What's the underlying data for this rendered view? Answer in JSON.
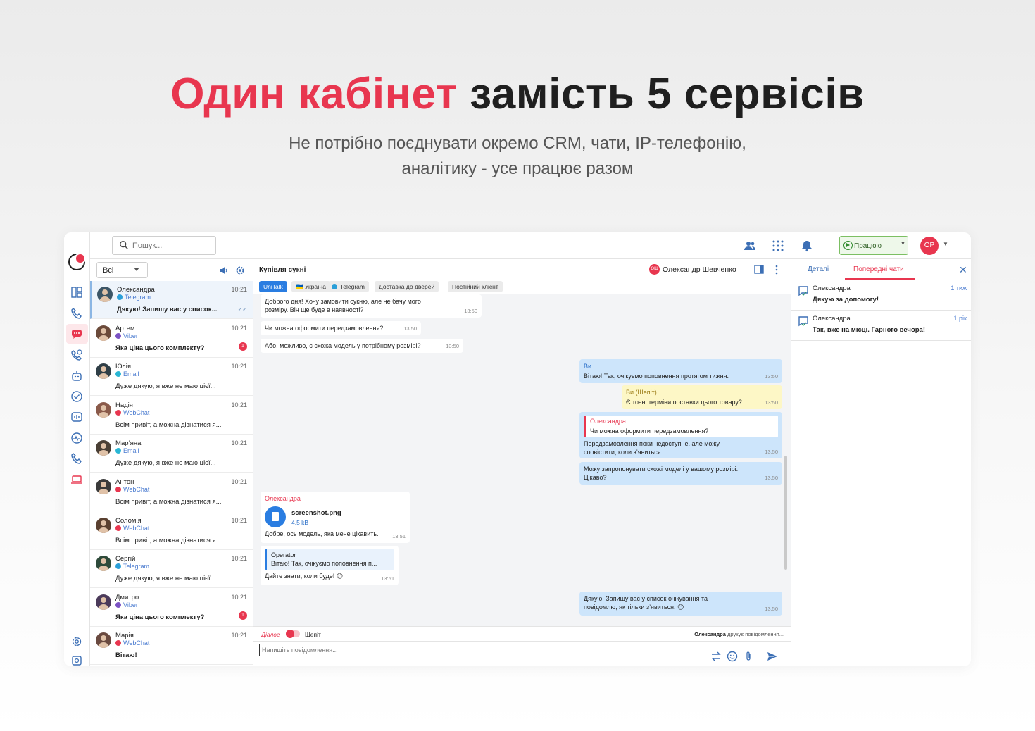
{
  "hero": {
    "title_accent": "Один кабінет",
    "title_rest": "замість 5 сервісів",
    "subtitle_line1": "Не потрібно поєднувати окремо CRM, чати, IP-телефонію,",
    "subtitle_line2": "аналітику - усе працює разом"
  },
  "topbar": {
    "search_placeholder": "Пошук...",
    "status_label": "Працюю",
    "user_initials": "ОР"
  },
  "convlist": {
    "filter_value": "Всі",
    "items": [
      {
        "name": "Олександра",
        "channel": "Telegram",
        "channel_color": "#2a9fd8",
        "time": "10:21",
        "message": "Дякую! Запишу вас у список...",
        "bold": true,
        "badge": "",
        "selected": true
      },
      {
        "name": "Артем",
        "channel": "Viber",
        "channel_color": "#7b52c4",
        "time": "10:21",
        "message": "Яка ціна цього комплекту?",
        "bold": true,
        "badge": "1",
        "selected": false
      },
      {
        "name": "Юлія",
        "channel": "Email",
        "channel_color": "#29b6d4",
        "time": "10:21",
        "message": "Дуже дякую, я вже не маю цієї...",
        "bold": false,
        "badge": "",
        "selected": false
      },
      {
        "name": "Надія",
        "channel": "WebChat",
        "channel_color": "#e8364f",
        "time": "10:21",
        "message": "Всім привіт, а можна дізнатися я...",
        "bold": false,
        "badge": "",
        "selected": false
      },
      {
        "name": "Мар’яна",
        "channel": "Email",
        "channel_color": "#29b6d4",
        "time": "10:21",
        "message": "Дуже дякую, я вже не маю цієї...",
        "bold": false,
        "badge": "",
        "selected": false
      },
      {
        "name": "Антон",
        "channel": "WebChat",
        "channel_color": "#e8364f",
        "time": "10:21",
        "message": "Всім привіт, а можна дізнатися я...",
        "bold": false,
        "badge": "",
        "selected": false
      },
      {
        "name": "Соломія",
        "channel": "WebChat",
        "channel_color": "#e8364f",
        "time": "10:21",
        "message": "Всім привіт, а можна дізнатися я...",
        "bold": false,
        "badge": "",
        "selected": false
      },
      {
        "name": "Сергій",
        "channel": "Telegram",
        "channel_color": "#2a9fd8",
        "time": "10:21",
        "message": "Дуже дякую, я вже не маю цієї...",
        "bold": false,
        "badge": "",
        "selected": false
      },
      {
        "name": "Дмитро",
        "channel": "Viber",
        "channel_color": "#7b52c4",
        "time": "10:21",
        "message": "Яка ціна цього комплекту?",
        "bold": true,
        "badge": "1",
        "selected": false
      },
      {
        "name": "Марія",
        "channel": "WebChat",
        "channel_color": "#e8364f",
        "time": "10:21",
        "message": "Вітаю!",
        "bold": true,
        "badge": "",
        "selected": false
      }
    ]
  },
  "chat": {
    "title": "Купівля сукні",
    "agent_initials": "ОШ",
    "agent_name": "Олександр Шевченко",
    "tags": [
      "UniTalk",
      "🇺🇦 Україна",
      "Telegram",
      "Доставка до дверей",
      "Постійний клієнт"
    ],
    "messages": {
      "m1_text": "Доброго дня! Хочу замовити сукню, але не бачу мого розміру. Він ще буде в наявності?",
      "m1_time": "13:50",
      "m2_text": "Чи можна оформити передзамовлення?",
      "m2_time": "13:50",
      "m3_text": "Або, можливо, є схожа модель у потрібному розмірі?",
      "m3_time": "13:50",
      "m4_author": "Ви",
      "m4_text": "Вітаю! Так, очікуємо поповнення протягом тижня.",
      "m4_time": "13:50",
      "m5_author": "Ви (Шепіт)",
      "m5_text": "Є точні терміни поставки цього товару?",
      "m5_time": "13:50",
      "m6_quote_author": "Олександра",
      "m6_quote_text": "Чи можна оформити передзамовлення?",
      "m6_text": "Передзамовлення поки недоступне, але можу сповістити, коли з’явиться.",
      "m6_time": "13:50",
      "m7_text": "Можу запропонувати схожі моделі у вашому розмірі. Цікаво?",
      "m7_time": "13:50",
      "m8_author": "Олександра",
      "m8_file": "screenshot.png",
      "m8_size": "4.5 kB",
      "m8_text": "Добре, ось модель, яка мене цікавить.",
      "m8_time": "13:51",
      "m9_quote_author": "Operator",
      "m9_quote_text": "Вітаю! Так, очікуємо поповнення п...",
      "m9_text": "Дайте знати, коли буде! 😊",
      "m9_time": "13:51",
      "m10_text": "Дякую! Запишу вас у список очікування та повідомлю, як тільки з’явиться. 😊",
      "m10_time": "13:50"
    },
    "mode_dialog": "Діалог",
    "mode_whisper": "Шепіт",
    "typing_name": "Олександра",
    "typing_text": " друкує повідомлення...",
    "composer_placeholder": "Напишіть повідомлення..."
  },
  "rpanel": {
    "tab_details": "Деталі",
    "tab_previous": "Попередні чати",
    "items": [
      {
        "name": "Олександра",
        "time": "1 тиж",
        "message": "Дякую за допомогу!"
      },
      {
        "name": "Олександра",
        "time": "1 рік",
        "message": "Так, вже на місці. Гарного вечора!"
      }
    ]
  },
  "colors": {
    "accent": "#e8364f",
    "primary": "#2a7de1",
    "outgoing": "#cde5fb",
    "whisper": "#fdf7c6"
  }
}
